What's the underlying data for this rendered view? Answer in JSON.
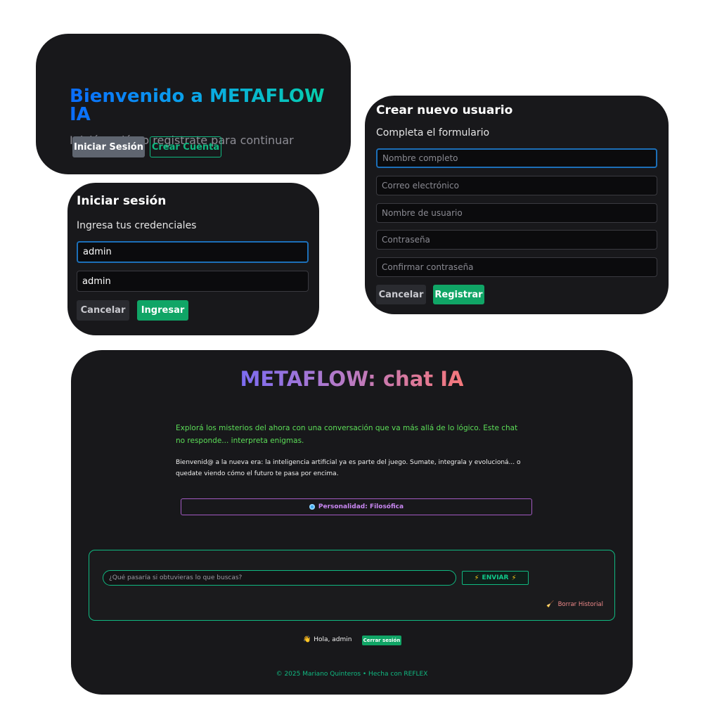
{
  "welcome": {
    "title": "Bienvenido a METAFLOW IA",
    "subtitle": "Iniciá sesión o registrate para continuar",
    "login_button": "Iniciar Sesión",
    "create_button": "Crear Cuenta"
  },
  "login": {
    "title": "Iniciar sesión",
    "subtitle": "Ingresa tus credenciales",
    "username_value": "admin",
    "password_value": "admin",
    "cancel": "Cancelar",
    "submit": "Ingresar"
  },
  "register": {
    "title": "Crear nuevo usuario",
    "subtitle": "Completa el formulario",
    "fields": [
      "Nombre completo",
      "Correo electrónico",
      "Nombre de usuario",
      "Contraseña",
      "Confirmar contraseña"
    ],
    "cancel": "Cancelar",
    "submit": "Registrar"
  },
  "chat": {
    "title": "METAFLOW: chat IA",
    "intro": "Explorá los misterios del ahora con una conversación que va más allá de lo lógico. Este chat no responde... interpreta enigmas.",
    "welcome": "Bienvenid@ a la nueva era: la inteligencia artificial ya es parte del juego. Sumate, integrala y evolucioná... o quedate viendo cómo el futuro te pasa por encima.",
    "personality": "Personalidad: Filosófica",
    "input_placeholder": "¿Qué pasaría si obtuvieras lo que buscas?",
    "send": "ENVIAR",
    "clear_history": "Borrar Historial",
    "greeting_emoji": "👋",
    "greeting": "Hola, admin",
    "logout": "Cerrar sesión",
    "footer": "© 2025 Mariano Quinteros • Hecha con REFLEX"
  },
  "colors": {
    "accent_green": "#10b981",
    "card_bg": "#18181b",
    "personality_border": "#a35ac3"
  }
}
